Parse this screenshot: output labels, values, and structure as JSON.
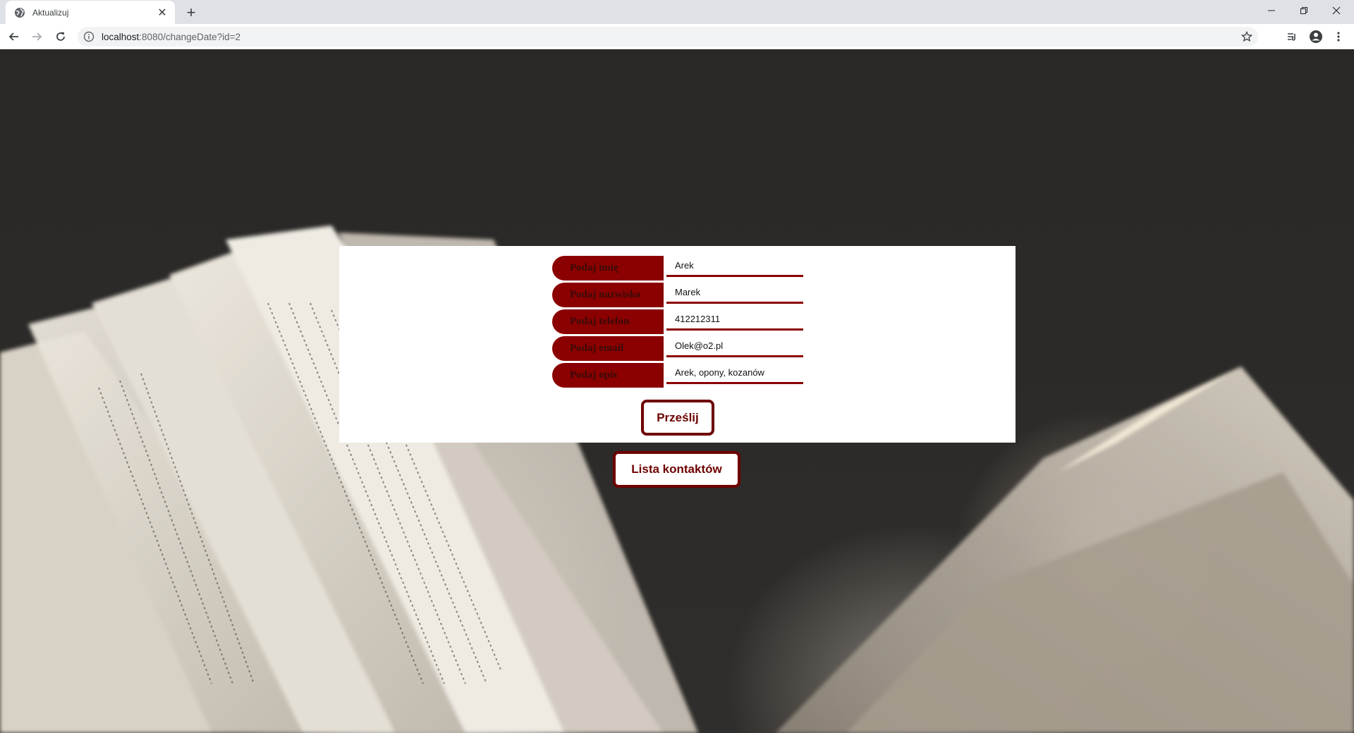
{
  "browser": {
    "tab_title": "Aktualizuj",
    "url_host": "localhost",
    "url_rest": ":8080/changeDate?id=2"
  },
  "form": {
    "fields": [
      {
        "label": "Podaj imię",
        "value": "Arek"
      },
      {
        "label": "Podaj nazwisko",
        "value": "Marek"
      },
      {
        "label": "Podaj telefon",
        "value": "412212311"
      },
      {
        "label": "Podaj email",
        "value": "Olek@o2.pl"
      },
      {
        "label": "Podaj opis",
        "value": "Arek, opony, kozanów"
      }
    ],
    "submit_label": "Prześlij"
  },
  "list_button_label": "Lista kontaktów",
  "colors": {
    "accent": "#8b0000",
    "button_border": "#6e0000"
  }
}
